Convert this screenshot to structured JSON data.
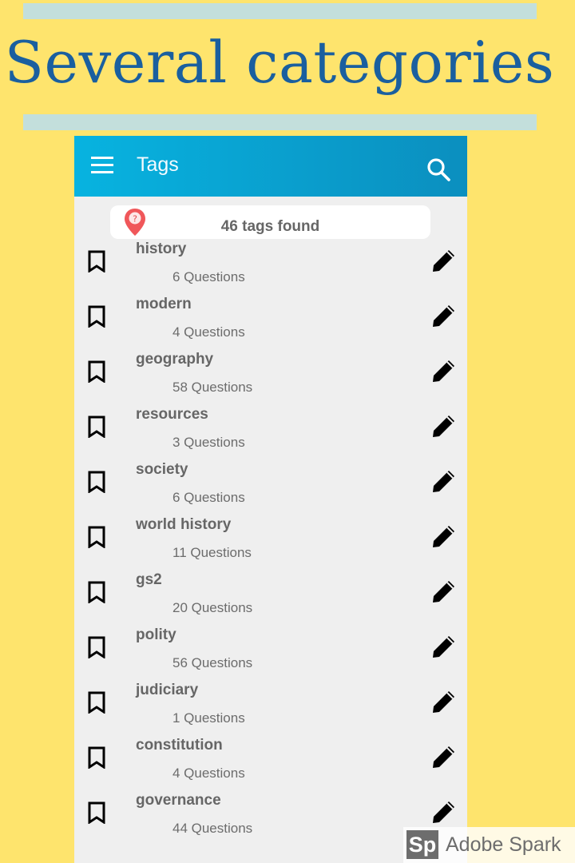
{
  "headline": "Several categories",
  "appbar": {
    "title": "Tags",
    "menu_icon": "hamburger-menu-icon",
    "search_icon": "search-icon"
  },
  "summary": {
    "text": "46 tags found",
    "icon": "map-pin-question-icon"
  },
  "tags": [
    {
      "name": "history",
      "count": "6 Questions"
    },
    {
      "name": "modern",
      "count": "4 Questions"
    },
    {
      "name": "geography",
      "count": "58 Questions"
    },
    {
      "name": "resources",
      "count": "3 Questions"
    },
    {
      "name": "society",
      "count": "6 Questions"
    },
    {
      "name": "world history",
      "count": "11 Questions"
    },
    {
      "name": "gs2",
      "count": "20 Questions"
    },
    {
      "name": "polity",
      "count": "56 Questions"
    },
    {
      "name": "judiciary",
      "count": "1 Questions"
    },
    {
      "name": "constitution",
      "count": "4 Questions"
    },
    {
      "name": "governance",
      "count": "44 Questions"
    }
  ],
  "row_icons": {
    "left": "bookmark-icon",
    "right": "edit-pencil-icon"
  },
  "watermark": {
    "logo": "Sp",
    "text": "Adobe Spark"
  },
  "colors": {
    "background": "#fee46d",
    "accent_bar": "#c3dfdc",
    "headline": "#1a5f9f",
    "appbar": "#07b3e0",
    "list_bg": "#efefef"
  }
}
